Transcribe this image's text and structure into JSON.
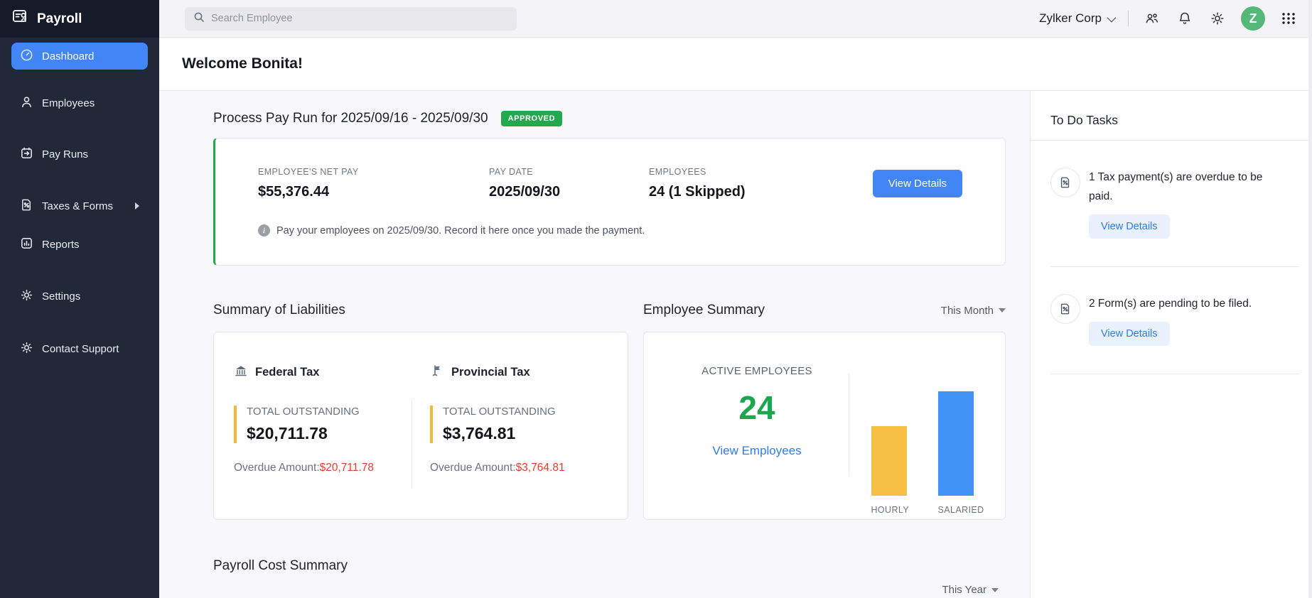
{
  "app": {
    "name": "Payroll"
  },
  "topbar": {
    "search_placeholder": "Search Employee",
    "org_name": "Zylker Corp",
    "icons": [
      "users-icon",
      "bell-icon",
      "gear-icon",
      "avatar",
      "apps-grid-icon"
    ],
    "avatar_letter": "Z"
  },
  "sidebar": {
    "items": [
      {
        "label": "Dashboard",
        "icon": "dashboard-icon",
        "active": true
      },
      {
        "label": "Employees",
        "icon": "employees-icon",
        "active": false
      },
      {
        "label": "Pay Runs",
        "icon": "pay-runs-icon",
        "active": false
      },
      {
        "label": "Taxes & Forms",
        "icon": "taxes-forms-icon",
        "active": false,
        "has_submenu": true
      },
      {
        "label": "Reports",
        "icon": "reports-icon",
        "active": false
      },
      {
        "label": "Settings",
        "icon": "settings-icon",
        "active": false
      },
      {
        "label": "Contact Support",
        "icon": "support-icon",
        "active": false
      }
    ]
  },
  "welcome": {
    "title": "Welcome Bonita!"
  },
  "pay_run": {
    "title": "Process Pay Run for 2025/09/16 - 2025/09/30",
    "status": "APPROVED",
    "stats": [
      {
        "label": "EMPLOYEE'S NET PAY",
        "value": "$55,376.44"
      },
      {
        "label": "PAY DATE",
        "value": "2025/09/30"
      },
      {
        "label": "EMPLOYEES",
        "value": "24 (1 Skipped)"
      }
    ],
    "cta": "View Details",
    "note": "Pay your employees on 2025/09/30. Record it here once you made the payment."
  },
  "liabilities": {
    "heading": "Summary of Liabilities",
    "items": [
      {
        "name": "Federal Tax",
        "icon": "bank-icon",
        "label": "TOTAL OUTSTANDING",
        "amount": "$20,711.78",
        "overdue_label": "Overdue Amount:",
        "overdue_amount": "$20,711.78"
      },
      {
        "name": "Provincial Tax",
        "icon": "flag-icon",
        "label": "TOTAL OUTSTANDING",
        "amount": "$3,764.81",
        "overdue_label": "Overdue Amount:",
        "overdue_amount": "$3,764.81"
      }
    ]
  },
  "employee_summary": {
    "heading": "Employee Summary",
    "filter": "This Month",
    "active_label": "ACTIVE EMPLOYEES",
    "active_count": "24",
    "link": "View Employees"
  },
  "chart_data": {
    "type": "bar",
    "title": "Employee Summary — employees by pay type (This Month)",
    "categories": [
      "HOURLY",
      "SALARIED"
    ],
    "values": [
      10,
      15
    ],
    "values_estimated": true,
    "colors": [
      "#f5c043",
      "#4193f5"
    ],
    "xlabel": "",
    "ylabel": "",
    "grid": false,
    "legend": "none"
  },
  "payroll_cost": {
    "heading": "Payroll Cost Summary",
    "filter": "This Year"
  },
  "todo": {
    "heading": "To Do Tasks",
    "tasks": [
      {
        "icon": "tax-document-icon",
        "text": "1 Tax payment(s) are overdue to be paid.",
        "action": "View Details"
      },
      {
        "icon": "form-document-icon",
        "text": "2 Form(s) are pending to be filed.",
        "action": "View Details"
      }
    ]
  },
  "colors": {
    "sidebar_bg": "#212838",
    "sidebar_logo_bg": "#161b29",
    "active_nav": "#4285f4",
    "primary_button": "#4285f4",
    "approved_badge": "#21a94c",
    "payrun_card_accent": "#21a94c",
    "outstanding_accent": "#f6b934",
    "overdue_red": "#ea3b2e",
    "active_count_green": "#1ca64f",
    "link_blue": "#2f7bf2",
    "avatar_green": "#54b878",
    "bar_hourly": "#f5c043",
    "bar_salaried": "#4193f5"
  }
}
